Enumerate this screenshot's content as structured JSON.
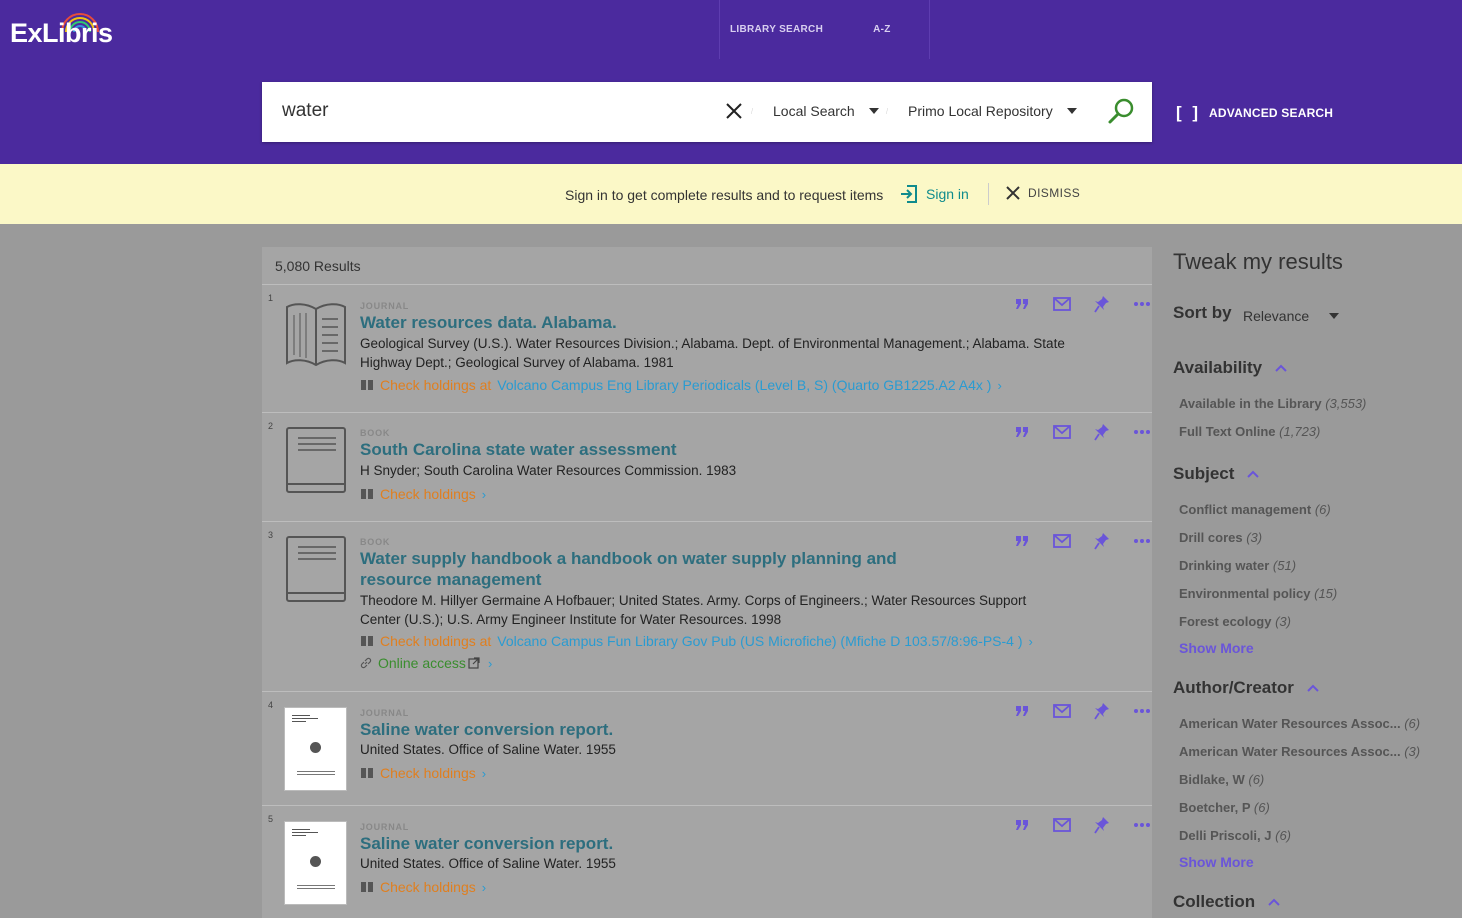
{
  "brand": {
    "logo": "ExLibris"
  },
  "topnav": {
    "items": [
      "LIBRARY SEARCH",
      "A-Z"
    ]
  },
  "search": {
    "query": "water",
    "scope": "Local Search",
    "tab": "Primo Local Repository",
    "advanced_label": "ADVANCED SEARCH",
    "icons": {
      "clear": "close-icon",
      "go": "search-icon"
    }
  },
  "signin_bar": {
    "message": "Sign in to get complete results and to request items",
    "signin_label": "Sign in",
    "dismiss_label": "DISMISS"
  },
  "results": {
    "count": "5,080 Results",
    "items": [
      {
        "index": "1",
        "type": "JOURNAL",
        "title": "Water resources data. Alabama.",
        "author_line1": "Geological Survey (U.S.). Water Resources Division.; Alabama. Dept. of Environmental Management.; Alabama. State",
        "author_line2": "Highway Dept.; Geological Survey of Alabama. 1981",
        "availability": "Check holdings at",
        "location": "Volcano Campus Eng Library Periodicals (Level B, S) (Quarto GB1225.A2 A4x )"
      },
      {
        "index": "2",
        "type": "BOOK",
        "title": "South Carolina state water assessment",
        "author_line1": "H Snyder; South Carolina Water Resources Commission. 1983",
        "availability": "Check holdings"
      },
      {
        "index": "3",
        "type": "BOOK",
        "title_line1": "Water supply handbook a handbook on water supply planning and",
        "title_line2": "resource management",
        "author_line1": "Theodore M. Hillyer Germaine A Hofbauer; United States. Army. Corps of Engineers.; Water Resources Support",
        "author_line2": "Center (U.S.); U.S. Army Engineer Institute for Water Resources. 1998",
        "availability": "Check holdings at",
        "location": "Volcano Campus Fun Library Gov Pub (US Microfiche) (Mfiche D 103.57/8:96-PS-4 )",
        "online": "Online access"
      },
      {
        "index": "4",
        "type": "JOURNAL",
        "title": "Saline water conversion report.",
        "author_line1": "United States. Office of Saline Water. 1955",
        "availability": "Check holdings"
      },
      {
        "index": "5",
        "type": "JOURNAL",
        "title": "Saline water conversion report.",
        "author_line1": "United States. Office of Saline Water. 1955",
        "availability": "Check holdings"
      }
    ],
    "action_icons": [
      "citation-icon",
      "email-icon",
      "pin-icon",
      "more-icon"
    ]
  },
  "facets": {
    "title": "Tweak my results",
    "sort_label": "Sort by",
    "sort_value": "Relevance",
    "availability": {
      "label": "Availability",
      "items": [
        {
          "name": "Available in the Library",
          "count": "(3,553)"
        },
        {
          "name": "Full Text Online",
          "count": "(1,723)"
        }
      ]
    },
    "subject": {
      "label": "Subject",
      "items": [
        {
          "name": "Conflict management",
          "count": "(6)"
        },
        {
          "name": "Drill cores",
          "count": "(3)"
        },
        {
          "name": "Drinking water",
          "count": "(51)"
        },
        {
          "name": "Environmental policy",
          "count": "(15)"
        },
        {
          "name": "Forest ecology",
          "count": "(3)"
        }
      ],
      "show_more": "Show More"
    },
    "author": {
      "label": "Author/Creator",
      "items": [
        {
          "name": "American Water Resources Assoc...",
          "count": "(6)"
        },
        {
          "name": "American Water Resources Assoc...",
          "count": "(3)"
        },
        {
          "name": "Bidlake, W",
          "count": "(6)"
        },
        {
          "name": "Boetcher, P",
          "count": "(6)"
        },
        {
          "name": "Delli Priscoli, J",
          "count": "(6)"
        }
      ],
      "show_more": "Show More"
    },
    "collection": {
      "label": "Collection"
    }
  },
  "colors": {
    "brand": "#4b2a9e",
    "title": "#2d6e7e",
    "holdings": "#e07f1f",
    "location": "#2a9bd1",
    "online": "#3a8d2e",
    "accent": "#6a55d9"
  }
}
